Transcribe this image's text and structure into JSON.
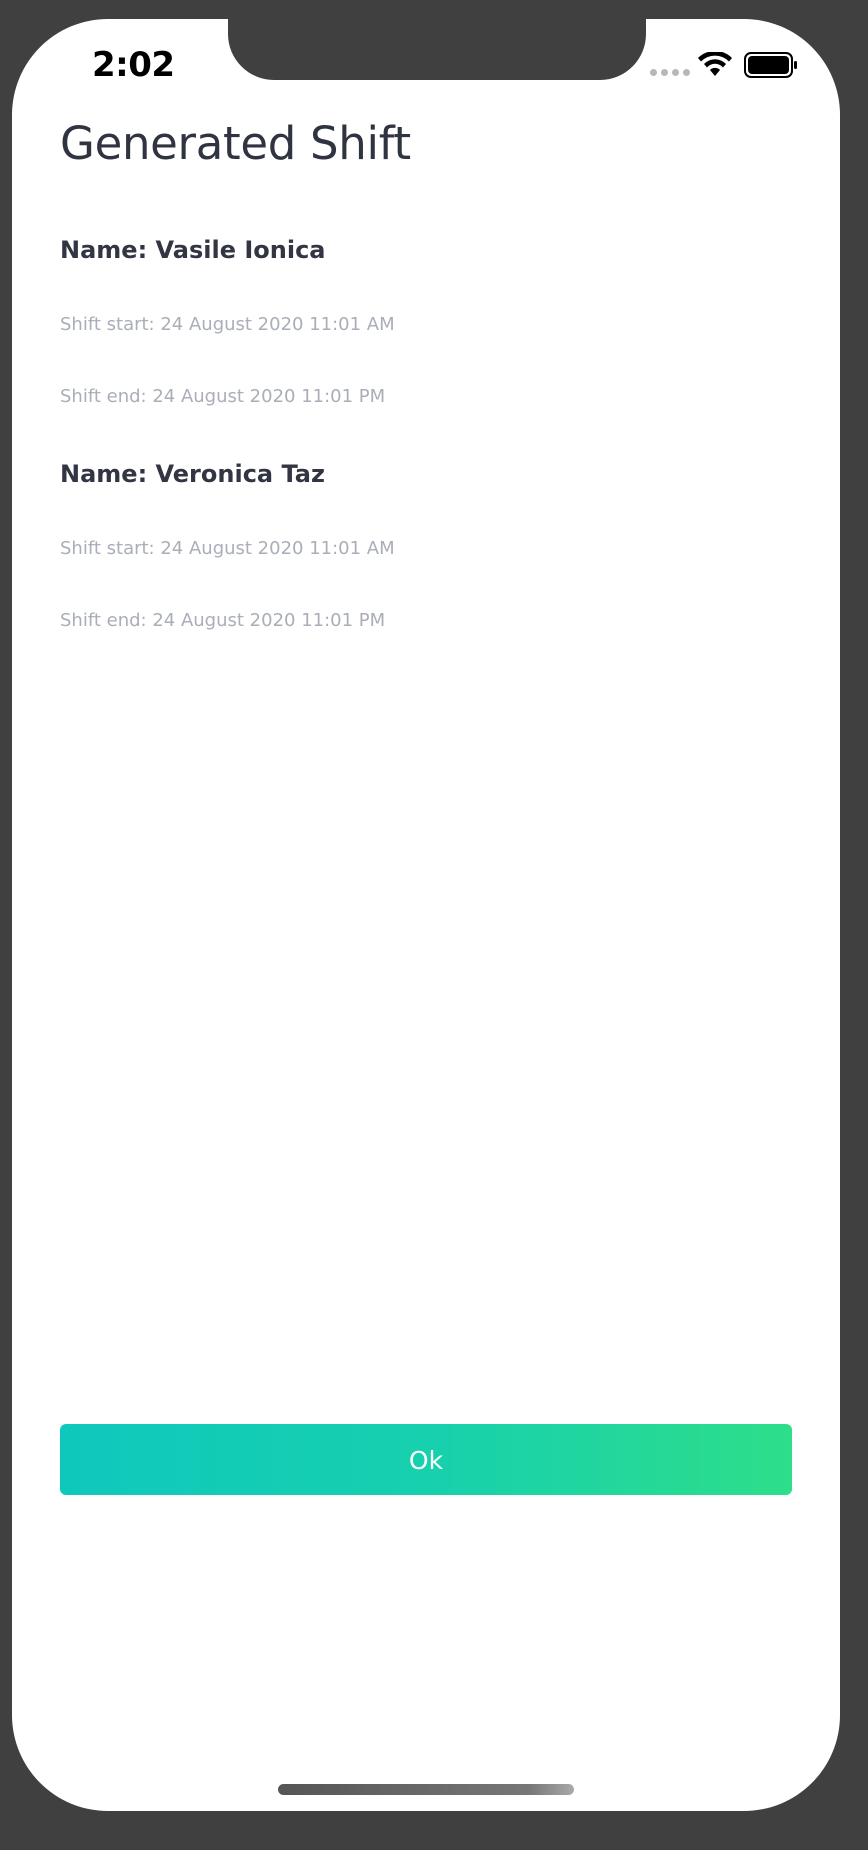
{
  "status_bar": {
    "time": "2:02"
  },
  "page": {
    "title": "Generated Shift"
  },
  "shifts": [
    {
      "name": "Name: Vasile Ionica",
      "start": "Shift start: 24 August 2020 11:01 AM",
      "end": "Shift end: 24 August 2020 11:01 PM"
    },
    {
      "name": "Name: Veronica Taz",
      "start": "Shift start: 24 August 2020 11:01 AM",
      "end": "Shift end: 24 August 2020 11:01 PM"
    }
  ],
  "actions": {
    "ok_label": "Ok"
  },
  "colors": {
    "button_gradient_start": "#0fc8bd",
    "button_gradient_end": "#2dde8a",
    "title_text": "#2f3440",
    "secondary_text": "#a9aeb8",
    "frame": "#404040"
  },
  "icons": [
    "signal-dots-icon",
    "wifi-icon",
    "battery-icon"
  ]
}
